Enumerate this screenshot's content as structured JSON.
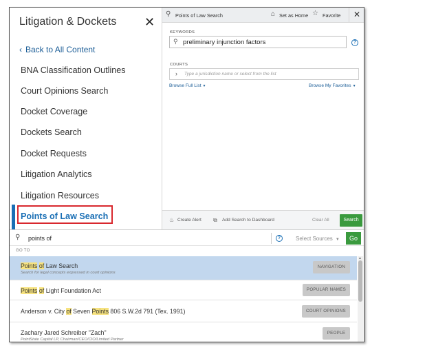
{
  "nav": {
    "title": "Litigation & Dockets",
    "back_label": "Back to All Content",
    "items": [
      "BNA Classification Outlines",
      "Court Opinions Search",
      "Docket Coverage",
      "Dockets Search",
      "Docket Requests",
      "Litigation Analytics",
      "Litigation Resources",
      "Points of Law Search"
    ],
    "active_item": "Points of Law Search"
  },
  "panel": {
    "title": "Points of Law Search",
    "set_home": "Set as Home",
    "favorite": "Favorite",
    "keywords_label": "KEYWORDS",
    "keywords_value": "preliminary injunction factors",
    "courts_label": "COURTS",
    "courts_placeholder": "Type a jurisdiction name or select from the list",
    "browse_full": "Browse Full List",
    "browse_favorites": "Browse My Favorites",
    "create_alert": "Create Alert",
    "add_dashboard": "Add Search to Dashboard",
    "clear_all": "Clear All",
    "search_button": "Search"
  },
  "global_search": {
    "value": "points of",
    "sources": "Select Sources",
    "go": "Go",
    "goto_label": "GO TO"
  },
  "results": [
    {
      "title_parts": [
        [
          "Points",
          true
        ],
        [
          " ",
          false
        ],
        [
          "of",
          true
        ],
        [
          " Law Search",
          false
        ]
      ],
      "subtitle": "Search for legal concepts expressed in court opinions",
      "tag": "NAVIGATION",
      "selected": true
    },
    {
      "title_parts": [
        [
          "Points",
          true
        ],
        [
          " ",
          false
        ],
        [
          "of",
          true
        ],
        [
          " Light Foundation Act",
          false
        ]
      ],
      "subtitle": "",
      "tag": "POPULAR NAMES",
      "selected": false
    },
    {
      "title_parts": [
        [
          "Anderson v. City ",
          false
        ],
        [
          "of",
          true
        ],
        [
          " Seven ",
          false
        ],
        [
          "Points",
          true
        ],
        [
          " 806 S.W.2d 791 (Tex. 1991)",
          false
        ]
      ],
      "subtitle": "",
      "tag": "COURT OPINIONS",
      "selected": false
    },
    {
      "title_parts": [
        [
          "Zachary Jared Schreiber \"Zach\"",
          false
        ]
      ],
      "subtitle": "PointState Capital LP, Chairman/CEO/CIO/Limited Partner",
      "tag": "PEOPLE",
      "selected": false
    }
  ],
  "colors": {
    "accent_blue": "#1a6fb5",
    "highlight_red": "#d8272d",
    "green": "#3a9a3e",
    "selected_row": "#c2d7ee"
  }
}
